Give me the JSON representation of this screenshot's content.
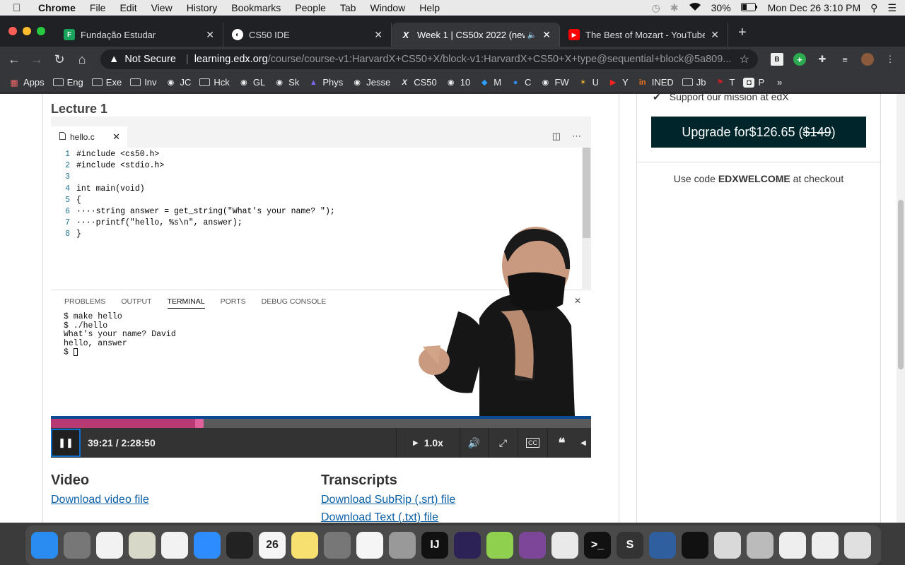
{
  "menubar": {
    "app": "Chrome",
    "items": [
      "File",
      "Edit",
      "View",
      "History",
      "Bookmarks",
      "People",
      "Tab",
      "Window",
      "Help"
    ],
    "battery": "30%",
    "datetime": "Mon Dec 26  3:10 PM"
  },
  "tabs": [
    {
      "title": "Fundação Estudar",
      "icon": "fundacao-icon",
      "color": "#1aa35a"
    },
    {
      "title": "CS50 IDE",
      "icon": "cs50-icon",
      "color": "#ffffff"
    },
    {
      "title": "Week 1 | CS50x 2022 (new",
      "icon": "edx-icon",
      "color": "#ffffff",
      "active": true
    },
    {
      "title": "The Best of Mozart - YouTube",
      "icon": "youtube-icon",
      "color": "#ff0000"
    }
  ],
  "omnibox": {
    "security": "Not Secure",
    "host": "learning.edx.org",
    "path": "/course/course-v1:HarvardX+CS50+X/block-v1:HarvardX+CS50+X+type@sequential+block@5a809..."
  },
  "bookmarks": [
    {
      "label": "Apps",
      "icon": "apps-grid-icon"
    },
    {
      "label": "Eng",
      "icon": "folder-icon"
    },
    {
      "label": "Exe",
      "icon": "folder-icon"
    },
    {
      "label": "Inv",
      "icon": "folder-icon"
    },
    {
      "label": "JC",
      "icon": "globe-icon"
    },
    {
      "label": "Hck",
      "icon": "folder-icon"
    },
    {
      "label": "GL",
      "icon": "globe-icon"
    },
    {
      "label": "Sk",
      "icon": "globe-icon"
    },
    {
      "label": "Phys",
      "icon": "phys-icon"
    },
    {
      "label": "Jesse",
      "icon": "globe-icon"
    },
    {
      "label": "CS50",
      "icon": "edx-icon"
    },
    {
      "label": "10",
      "icon": "globe-icon"
    },
    {
      "label": "M",
      "icon": "m-icon"
    },
    {
      "label": "C",
      "icon": "c-icon"
    },
    {
      "label": "FW",
      "icon": "globe-icon"
    },
    {
      "label": "U",
      "icon": "u-icon"
    },
    {
      "label": "Y",
      "icon": "youtube-icon"
    },
    {
      "label": "INED",
      "icon": "ined-icon"
    },
    {
      "label": "Jb",
      "icon": "folder-icon"
    },
    {
      "label": "T",
      "icon": "flag-icon"
    },
    {
      "label": "P",
      "icon": "p-icon"
    }
  ],
  "lecture": {
    "title": "Lecture 1",
    "filename": "hello.c",
    "code": [
      "#include <cs50.h>",
      "#include <stdio.h>",
      "",
      "int main(void)",
      "{",
      "····string answer = get_string(\"What's your name? \");",
      "····printf(\"hello, %s\\n\", answer);",
      "}"
    ],
    "panel_tabs": [
      "PROBLEMS",
      "OUTPUT",
      "TERMINAL",
      "PORTS",
      "DEBUG CONSOLE"
    ],
    "terminal": "$ make hello\n$ ./hello\nWhat's your name? David\nhello, answer\n$ "
  },
  "player": {
    "time": "39:21 / 2:28:50",
    "progress": 0.2744,
    "speed": "1.0x"
  },
  "downloads": {
    "video_heading": "Video",
    "video_link": "Download video file",
    "transcripts_heading": "Transcripts",
    "srt_link": "Download SubRip (.srt) file",
    "txt_link": "Download Text (.txt) file"
  },
  "sidebar": {
    "support_text": "Support our mission at edX",
    "upgrade_prefix": "Upgrade for",
    "upgrade_price": "$126.65",
    "upgrade_old_price": "$149",
    "code_prefix": "Use code ",
    "code": "EDXWELCOME",
    "code_suffix": " at checkout"
  },
  "dock": [
    {
      "name": "finder-icon",
      "color": "#2a8cf0"
    },
    {
      "name": "system-preferences-icon",
      "color": "#777"
    },
    {
      "name": "music-icon",
      "color": "#f2f2f2"
    },
    {
      "name": "preview-icon",
      "color": "#d8d8c8"
    },
    {
      "name": "photos-icon",
      "color": "#f2f2f2"
    },
    {
      "name": "zoom-icon",
      "color": "#2d8cff"
    },
    {
      "name": "activity-monitor-icon",
      "color": "#222"
    },
    {
      "name": "calendar-icon",
      "color": "#f5f5f5",
      "label": "26"
    },
    {
      "name": "notes-icon",
      "color": "#f7e070"
    },
    {
      "name": "calculator-icon",
      "color": "#777"
    },
    {
      "name": "reminders-icon",
      "color": "#f5f5f5"
    },
    {
      "name": "launchpad-icon",
      "color": "#999"
    },
    {
      "name": "intellij-icon",
      "color": "#111",
      "label": "IJ"
    },
    {
      "name": "eclipse-icon",
      "color": "#2c2255"
    },
    {
      "name": "android-studio-icon",
      "color": "#8fd14f"
    },
    {
      "name": "tor-icon",
      "color": "#7d4698"
    },
    {
      "name": "chrome-icon",
      "color": "#e9e9e9"
    },
    {
      "name": "terminal-icon",
      "color": "#111",
      "label": ">_"
    },
    {
      "name": "sublime-icon",
      "color": "#333",
      "label": "S"
    },
    {
      "name": "virtualbox-icon",
      "color": "#2f5f9f"
    },
    {
      "name": "debian-icon",
      "color": "#111"
    },
    {
      "name": "parallels-icon",
      "color": "#d9d9d9"
    },
    {
      "name": "photo-library-icon",
      "color": "#bbb"
    },
    {
      "name": "document-icon",
      "color": "#eee"
    },
    {
      "name": "documents-folder-icon",
      "color": "#eee"
    },
    {
      "name": "trash-icon",
      "color": "#e0e0e0"
    }
  ]
}
